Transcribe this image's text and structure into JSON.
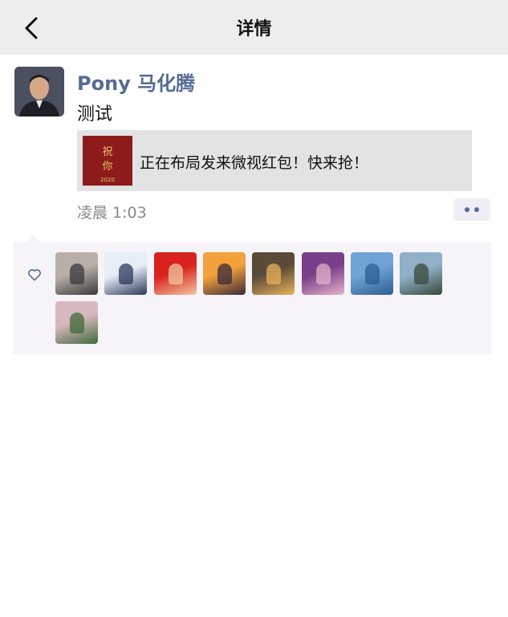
{
  "navbar": {
    "title": "详情",
    "back_icon": "chevron-left-icon"
  },
  "post": {
    "author": "Pony 马化腾",
    "text": "测试",
    "share": {
      "thumb_line1": "祝",
      "thumb_line2": "你",
      "thumb_year": "2020",
      "text": "正在布局发来微视红包！快来抢！"
    },
    "time": "凌晨 1:03",
    "more_icon": "more-dots-icon"
  },
  "likes": {
    "icon": "heart-outline-icon",
    "likers": [
      {
        "name": "liker-1",
        "colors": [
          "#b8b0a8",
          "#3a3a3a"
        ]
      },
      {
        "name": "liker-2",
        "colors": [
          "#e8eef6",
          "#2a3a5a"
        ]
      },
      {
        "name": "liker-3",
        "colors": [
          "#d8221e",
          "#f2c6a0"
        ]
      },
      {
        "name": "liker-4",
        "colors": [
          "#f3a13c",
          "#3a2a38"
        ]
      },
      {
        "name": "liker-5",
        "colors": [
          "#5a4a38",
          "#e9b25a"
        ]
      },
      {
        "name": "liker-6",
        "colors": [
          "#7a3f8a",
          "#e6b0c8"
        ]
      },
      {
        "name": "liker-7",
        "colors": [
          "#6fa3d8",
          "#2e5d8e"
        ]
      },
      {
        "name": "liker-8",
        "colors": [
          "#8fb0c8",
          "#3a4a3a"
        ]
      },
      {
        "name": "liker-9",
        "colors": [
          "#d8b8c0",
          "#3f6a38"
        ]
      }
    ]
  }
}
